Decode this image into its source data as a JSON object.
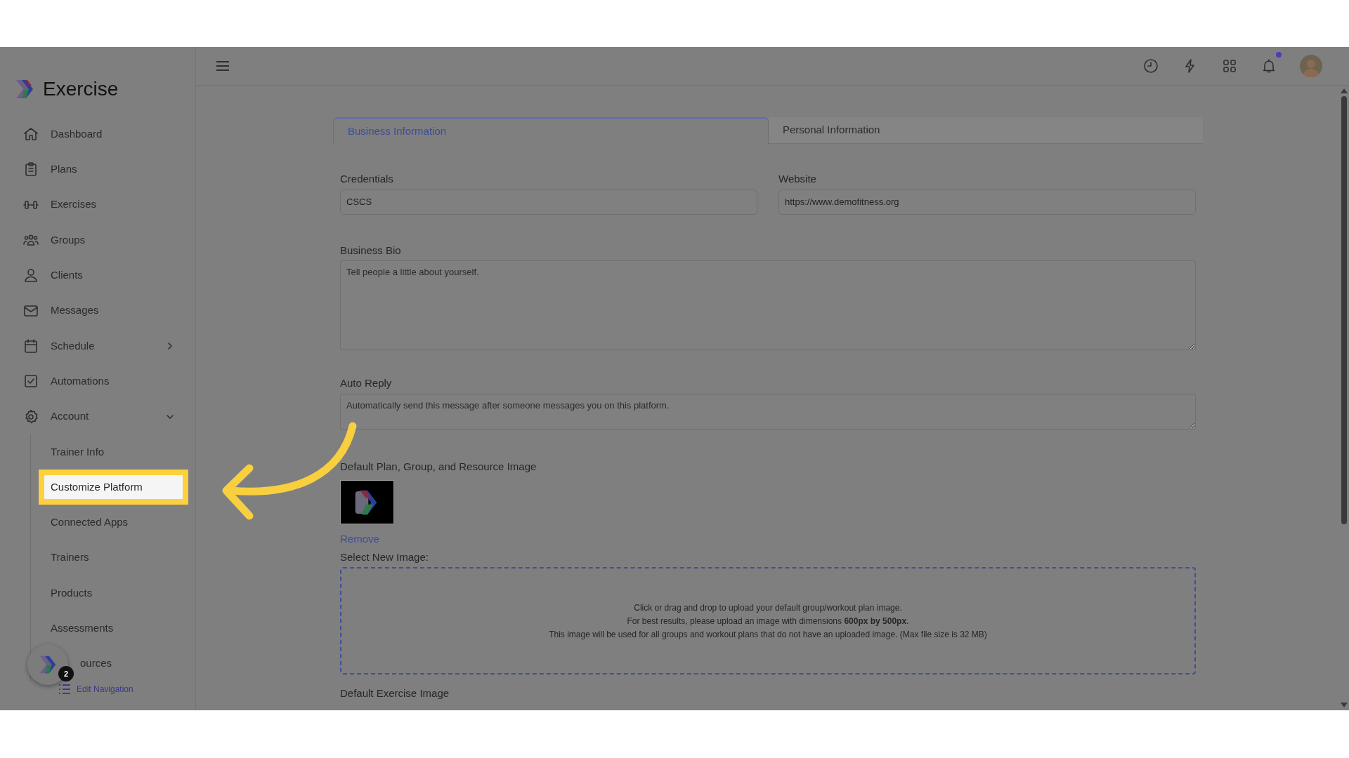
{
  "app": {
    "name": "Exercise"
  },
  "sidebar": {
    "items": [
      {
        "label": "Dashboard",
        "kind": "link"
      },
      {
        "label": "Plans",
        "kind": "link"
      },
      {
        "label": "Exercises",
        "kind": "link"
      },
      {
        "label": "Groups",
        "kind": "link"
      },
      {
        "label": "Clients",
        "kind": "link"
      },
      {
        "label": "Messages",
        "kind": "link"
      },
      {
        "label": "Schedule",
        "kind": "group",
        "expanded": false
      },
      {
        "label": "Automations",
        "kind": "link"
      },
      {
        "label": "Account",
        "kind": "group",
        "expanded": true,
        "children": [
          {
            "label": "Trainer Info",
            "selected": false
          },
          {
            "label": "Customize Platform",
            "selected": true
          },
          {
            "label": "Connected Apps",
            "selected": false
          },
          {
            "label": "Trainers",
            "selected": false
          },
          {
            "label": "Products",
            "selected": false
          },
          {
            "label": "Assessments",
            "selected": false
          },
          {
            "label": "ources",
            "selected": false
          }
        ]
      }
    ],
    "edit_navigation": "Edit Navigation",
    "chat_badge": "2"
  },
  "topbar": {
    "notifications_unread": true
  },
  "tabs": [
    {
      "label": "Business Information",
      "selected": true
    },
    {
      "label": "Personal Information",
      "selected": false
    }
  ],
  "form": {
    "credentials": {
      "label": "Credentials",
      "value": "CSCS"
    },
    "website": {
      "label": "Website",
      "value": "https://www.demofitness.org"
    },
    "business_bio": {
      "label": "Business Bio",
      "placeholder": "Tell people a little about yourself."
    },
    "auto_reply": {
      "label": "Auto Reply",
      "placeholder": "Automatically send this message after someone messages you on this platform."
    },
    "default_image": {
      "label": "Default Plan, Group, and Resource Image",
      "remove": "Remove",
      "select_label": "Select New Image:",
      "dropzone_lines": [
        "Click or drag and drop to upload your default group/workout plan image.",
        "For best results, please upload an image with dimensions **600px by 500px**.",
        "This image will be used for all groups and workout plans that do not have an uploaded image. (Max file size is 32 MB)"
      ]
    },
    "next_section": "Default Exercise Image"
  }
}
